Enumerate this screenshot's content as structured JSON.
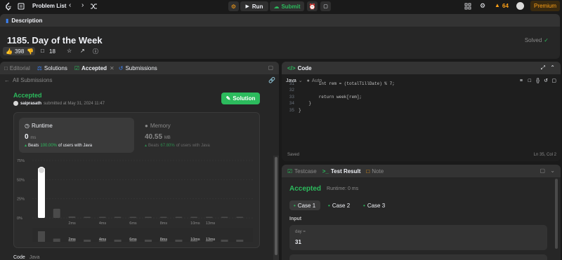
{
  "topbar": {
    "problem_list": "Problem List",
    "run": "Run",
    "submit": "Submit",
    "streak": "64",
    "premium": "Premium"
  },
  "description": {
    "tab": "Description",
    "title": "1185. Day of the Week",
    "status": "Solved",
    "likes": "398",
    "comments": "18"
  },
  "left_tabs": {
    "editorial": "Editorial",
    "solutions": "Solutions",
    "accepted": "Accepted",
    "submissions": "Submissions"
  },
  "submission": {
    "back": "All Submissions",
    "verdict": "Accepted",
    "user": "saiprasath",
    "submitted_text": "submitted at May 31, 2024 11:47",
    "solution_button": "Solution",
    "runtime_label": "Runtime",
    "runtime_value": "0",
    "runtime_unit": "ms",
    "runtime_beats_prefix": "Beats",
    "runtime_beats_pct": "100.00%",
    "runtime_beats_suffix": "of users with Java",
    "memory_label": "Memory",
    "memory_value": "40.55",
    "memory_unit": "MB",
    "memory_beats_prefix": "Beats",
    "memory_beats_pct": "67.80%",
    "memory_beats_suffix": "of users with Java",
    "code_label": "Code",
    "code_lang": "Java"
  },
  "chart_data": {
    "type": "bar",
    "y_ticks": [
      "75%",
      "50%",
      "25%",
      "0%"
    ],
    "ylim": [
      0,
      75
    ],
    "x_tick_labels": [
      "2ms",
      "4ms",
      "6ms",
      "8ms",
      "10ms",
      "13ms"
    ],
    "values": [
      65,
      12,
      2,
      1.5,
      1.5,
      1.5,
      1.5,
      1.5,
      1.5,
      1.5,
      1.5,
      1.5,
      1.5,
      1.5
    ],
    "highlight_index": 0,
    "mini_values": [
      10,
      3,
      2,
      2,
      2,
      2,
      2,
      2,
      2,
      2,
      2,
      2,
      2,
      2
    ],
    "mini_x_tick_labels": [
      "2ms",
      "4ms",
      "6ms",
      "8ms",
      "10ms",
      "13ms"
    ]
  },
  "code_panel": {
    "tab": "Code",
    "lang": "Java",
    "auto": "Auto",
    "lines": [
      {
        "n": "31",
        "text": "        int rem = (totalTillDate) % 7;"
      },
      {
        "n": "32",
        "text": ""
      },
      {
        "n": "33",
        "text": "        return week[rem];"
      },
      {
        "n": "34",
        "text": "    }"
      },
      {
        "n": "35",
        "text": "}"
      }
    ],
    "saved": "Saved",
    "cursor": "Ln 35, Col 2"
  },
  "test_panel": {
    "tab_testcase": "Testcase",
    "tab_result": "Test Result",
    "tab_note": "Note",
    "verdict": "Accepted",
    "runtime": "Runtime: 0 ms",
    "cases": [
      "Case 1",
      "Case 2",
      "Case 3"
    ],
    "input_label": "Input",
    "var_name": "day =",
    "var_value": "31"
  },
  "colors": {
    "accent_green": "#2cbb5d",
    "brand_orange": "#ffa116",
    "submit_green": "#2cbb5d"
  }
}
